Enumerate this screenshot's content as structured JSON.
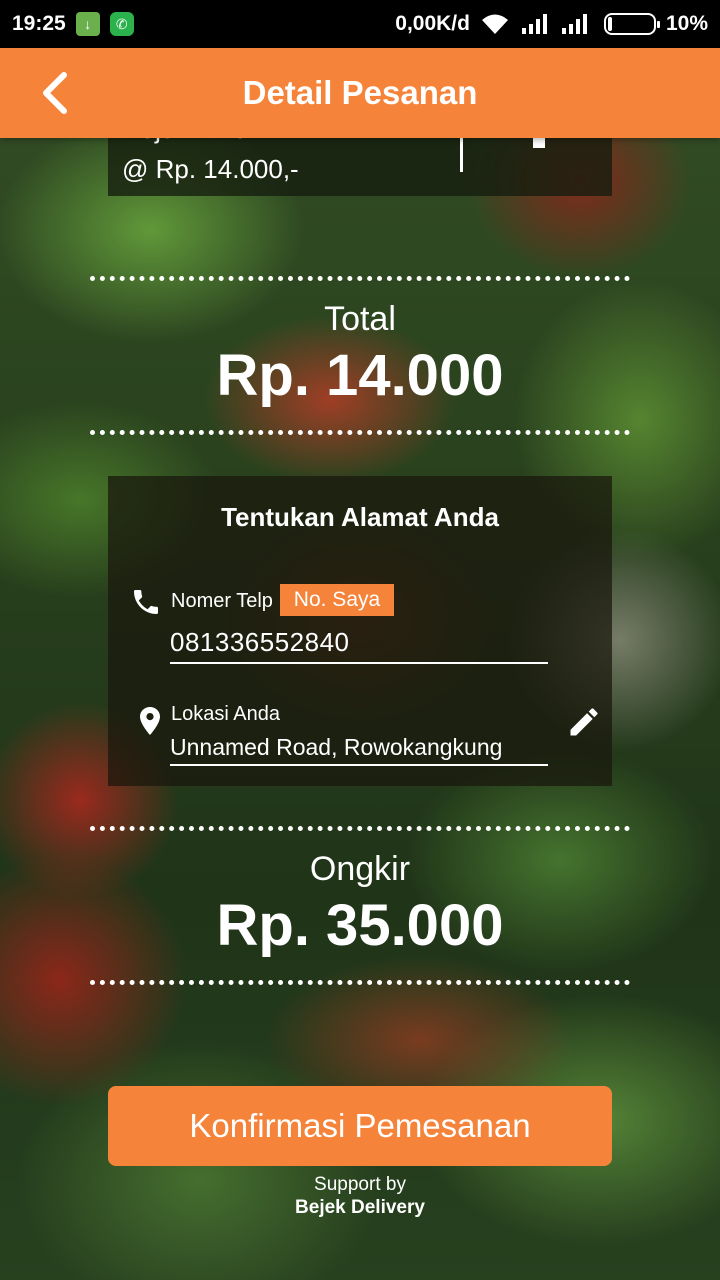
{
  "status_bar": {
    "time": "19:25",
    "network_speed": "0,00K/d",
    "battery": "10%",
    "battery_level": 0.1,
    "icons": [
      "download-icon",
      "whatsapp-icon",
      "wifi-icon",
      "signal-icon",
      "signal-icon",
      "battery-icon"
    ]
  },
  "header": {
    "title": "Detail Pesanan",
    "back_icon": "chevron-left-icon"
  },
  "order_item": {
    "name": "Keju E.T.C.",
    "price": "@ Rp. 14.000,-"
  },
  "total": {
    "label": "Total",
    "value": "Rp. 14.000"
  },
  "address": {
    "title": "Tentukan Alamat Anda",
    "phone_label": "Nomer Telp",
    "my_number_button": "No. Saya",
    "phone_value": "081336552840",
    "location_label": "Lokasi Anda",
    "location_value": "Unnamed Road, Rowokangkung"
  },
  "shipping": {
    "label": "Ongkir",
    "value": "Rp. 35.000"
  },
  "confirm_button": "Konfirmasi Pemesanan",
  "footer": {
    "support_label": "Support by",
    "brand": "Bejek Delivery"
  },
  "colors": {
    "accent": "#f5843a",
    "statusbar": "#000000"
  }
}
